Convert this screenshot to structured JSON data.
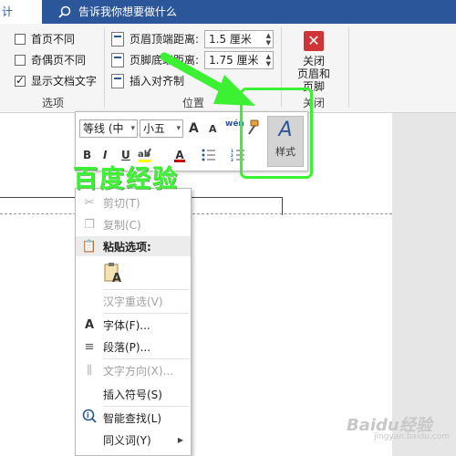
{
  "titlebar": {
    "tab_label": "计",
    "tell_me": "告诉我你想要做什么"
  },
  "ribbon": {
    "options_group": {
      "label": "选项",
      "items": [
        {
          "label": "首页不同",
          "checked": false
        },
        {
          "label": "奇偶页不同",
          "checked": false
        },
        {
          "label": "显示文档文字",
          "checked": true
        }
      ]
    },
    "position_group": {
      "label": "位置",
      "header_top_label": "页眉顶端距离:",
      "header_top_value": "1.5 厘米",
      "footer_bottom_label": "页脚底端距离:",
      "footer_bottom_value": "1.75 厘米",
      "insert_align_tab": "插入对齐制"
    },
    "close_group": {
      "label": "关闭",
      "button_line1": "关闭",
      "button_line2": "页眉和页脚"
    }
  },
  "minibar": {
    "font_name": "等线 (中",
    "font_size": "小五",
    "grow_font": "A",
    "shrink_font": "A",
    "phonetic": "wén",
    "bold": "B",
    "italic": "I",
    "underline": "U",
    "font_color": "A",
    "style_label": "样式"
  },
  "context_menu": {
    "items": [
      {
        "label": "剪切(T)",
        "icon": "scissors-icon",
        "disabled": true
      },
      {
        "label": "复制(C)",
        "icon": "copy-icon",
        "disabled": true
      },
      {
        "label": "粘贴选项:",
        "icon": "paste-icon",
        "disabled": false
      },
      {
        "label": "汉字重选(V)",
        "icon": "",
        "disabled": true
      },
      {
        "label": "字体(F)...",
        "icon": "font-icon",
        "disabled": false
      },
      {
        "label": "段落(P)...",
        "icon": "paragraph-icon",
        "disabled": false
      },
      {
        "label": "文字方向(X)...",
        "icon": "text-direction-icon",
        "disabled": true
      },
      {
        "label": "插入符号(S)",
        "icon": "",
        "disabled": false
      },
      {
        "label": "智能查找(L)",
        "icon": "smart-lookup-icon",
        "disabled": false
      },
      {
        "label": "同义词(Y)",
        "icon": "",
        "disabled": false
      }
    ]
  },
  "overlay": {
    "watermark": "百度经验",
    "logo": "Baidu经验",
    "logo_sub": "jingyan.baidu.com",
    "highlight_color": "#3cf032"
  },
  "colors": {
    "word_blue": "#2b579a",
    "close_red": "#d13438"
  }
}
